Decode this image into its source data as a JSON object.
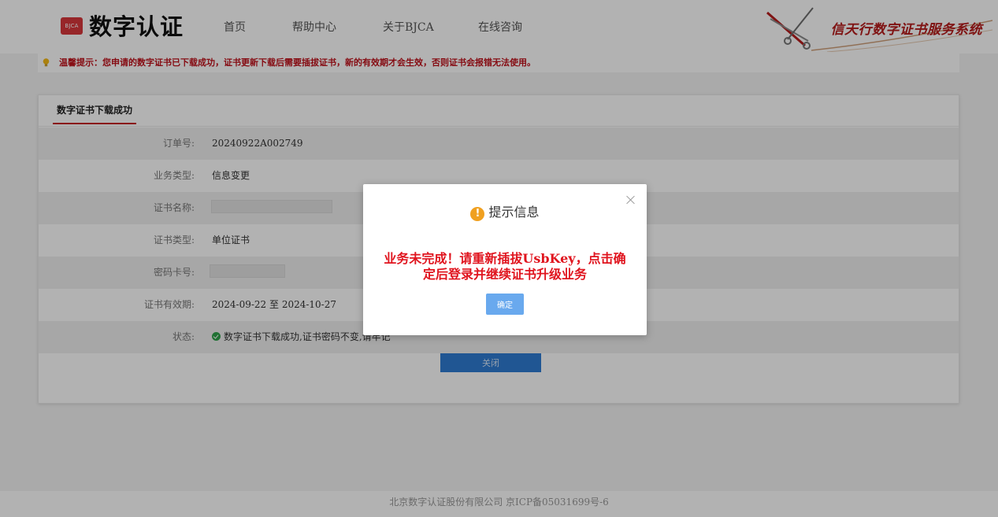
{
  "header": {
    "logo_badge": "BJCA",
    "logo_text": "数字认证",
    "nav": [
      {
        "label": "首页"
      },
      {
        "label": "帮助中心"
      },
      {
        "label": "关于BJCA"
      },
      {
        "label": "在线咨询"
      }
    ],
    "brand_title": "信天行数字证书服务系统"
  },
  "notice": {
    "icon": "lightbulb-icon",
    "text": "温馨提示：您申请的数字证书已下载成功，证书更新下载后需要插拔证书，新的有效期才会生效，否则证书会报错无法使用。"
  },
  "card": {
    "tab_label": "数字证书下载成功",
    "rows": [
      {
        "label": "订单号:",
        "value": "20240922A002749"
      },
      {
        "label": "业务类型:",
        "value": "信息变更"
      },
      {
        "label": "证书名称:",
        "value": ""
      },
      {
        "label": "证书类型:",
        "value": "单位证书"
      },
      {
        "label": "密码卡号:",
        "value": ""
      },
      {
        "label": "证书有效期:",
        "value": "2024-09-22 至 2024-10-27"
      },
      {
        "label": "状态:",
        "value": "数字证书下载成功,证书密码不变,请牢记"
      }
    ],
    "close_label": "关闭"
  },
  "footer": {
    "text": "北京数字认证股份有限公司 京ICP备05031699号-6"
  },
  "modal": {
    "title": "提示信息",
    "message": "业务未完成！请重新插拔UsbKey，点击确定后登录并继续证书升级业务",
    "ok_label": "确定"
  },
  "colors": {
    "brand_red": "#c4181d",
    "message_red": "#e0141e",
    "primary_blue": "#2f7cd3",
    "ok_blue": "#69a9ee",
    "warning_orange": "#f0a020",
    "success_green": "#2ea34a"
  }
}
